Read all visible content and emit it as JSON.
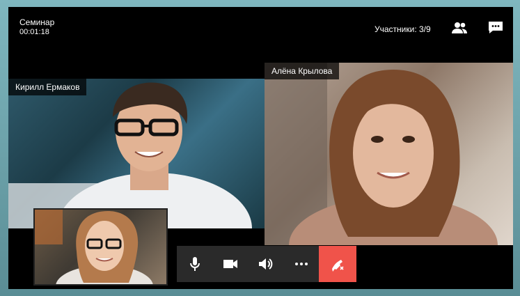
{
  "session": {
    "title": "Семинар",
    "timer": "00:01:18"
  },
  "header": {
    "participants_label": "Участники: 3/9",
    "participants_icon": "people-icon",
    "chat_icon": "chat-icon"
  },
  "participants": [
    {
      "name": "Кирилл Ермаков"
    },
    {
      "name": "Алёна Крылова"
    }
  ],
  "controls": {
    "items": [
      "microphone-icon",
      "camera-icon",
      "speaker-icon",
      "more-icon",
      "hangup-icon"
    ],
    "hangup_color": "#f0534a"
  },
  "colors": {
    "accent": "#f0534a",
    "bar": "#2a2a2a"
  }
}
